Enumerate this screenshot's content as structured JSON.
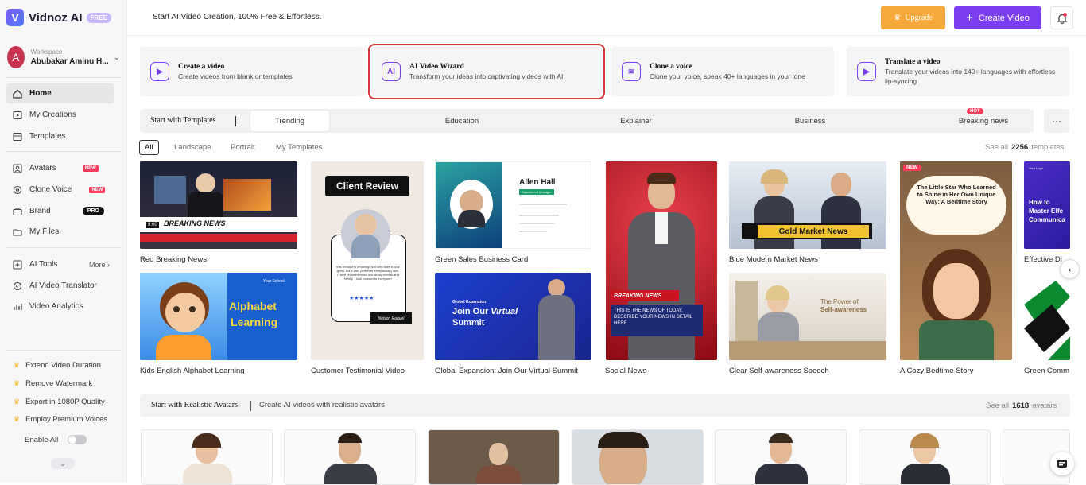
{
  "brand": {
    "name": "Vidnoz AI",
    "badge": "FREE"
  },
  "workspace": {
    "label": "Workspace",
    "name": "Abubakar Aminu H...",
    "initial": "A"
  },
  "nav": {
    "home": "Home",
    "my_creations": "My Creations",
    "templates": "Templates",
    "avatars": "Avatars",
    "clone_voice": "Clone Voice",
    "brand": "Brand",
    "my_files": "My Files",
    "ai_tools": "AI Tools",
    "more": "More",
    "ai_video_translator": "AI Video Translator",
    "video_analytics": "Video Analytics",
    "new_badge": "NEW",
    "pro_badge": "PRO"
  },
  "perks": [
    "Extend Video Duration",
    "Remove Watermark",
    "Export in 1080P Quality",
    "Employ Premium Voices"
  ],
  "enable_all": "Enable All",
  "topbar": {
    "tagline": "Start AI Video Creation, 100% Free & Effortless.",
    "upgrade": "Upgrade",
    "create_video": "Create Video"
  },
  "features": [
    {
      "title": "Create a video",
      "desc": "Create videos from blank or templates"
    },
    {
      "title": "AI Video Wizard",
      "desc": "Transform your ideas into captivating videos with AI"
    },
    {
      "title": "Clone a voice",
      "desc": "Clone your voice, speak 40+ languages in your tone"
    },
    {
      "title": "Translate a video",
      "desc": "Translate your videos into 140+ languages with effortless lip-syncing"
    }
  ],
  "template_bar": {
    "title": "Start with Templates",
    "tabs": [
      "Trending",
      "Education",
      "Explainer",
      "Business",
      "Breaking news"
    ],
    "hot": "HOT",
    "more": "···"
  },
  "filters": [
    "All",
    "Landscape",
    "Portrait",
    "My Templates"
  ],
  "see_all_templates": {
    "prefix": "See all",
    "count": "2256",
    "suffix": "templates"
  },
  "templates": {
    "red_breaking": {
      "caption": "Red Breaking News",
      "banner": "BREAKING NEWS",
      "time": "9:00"
    },
    "kids_alphabet": {
      "caption": "Kids English Alphabet Learning",
      "line1": "Alphabet",
      "line2": "Learning",
      "school": "Your School"
    },
    "testimonial": {
      "caption": "Customer Testimonial Video",
      "heading": "Client Review",
      "quote": "this product is amazing! Not only does it look great, but it also performs exceptionally well. I have recommended it to all my friends and family. I look forward to everyone!",
      "stars": "★★★★★",
      "name": "Nelson Raquel"
    },
    "business_card": {
      "caption": "Green Sales Business Card",
      "name": "Allen Hall",
      "role": "Department Manager"
    },
    "global_summit": {
      "caption": "Global Expansion: Join Our Virtual Summit",
      "small": "Global Expansion:",
      "line1": "Join Our",
      "italic": "Virtual",
      "line2": "Summit"
    },
    "social_news": {
      "caption": "Social News",
      "banner": "BREAKING NEWS",
      "text": "THIS IS THE  NEWS OF TODAY, DESCRIBE YOUR NEWS IN DETAIL HERE"
    },
    "market_news": {
      "caption": "Blue Modern Market News",
      "banner": "Gold Market News"
    },
    "self_awareness": {
      "caption": "Clear Self-awareness Speech",
      "small": "The Power of",
      "big": "Self-awareness"
    },
    "bedtime": {
      "caption": "A Cozy Bedtime Story",
      "badge": "NEW",
      "title": "The Little Star Who Learned to Shine in Her Own Unique Way: A Bedtime Story"
    },
    "partial1": {
      "caption": "Effective Di",
      "text": "How to Master Effe Communica",
      "logo": "Your Logo"
    },
    "partial2": {
      "caption": "Green Comm"
    }
  },
  "avatars_section": {
    "title": "Start with Realistic Avatars",
    "subtitle": "Create AI videos with realistic avatars",
    "see_prefix": "See all",
    "count": "1618",
    "suffix": "avatars"
  },
  "colors": {
    "accent": "#7b3ff2",
    "upgrade": "#f6a93a",
    "new": "#ff3b5c",
    "selected_outline": "#d43a3a"
  }
}
